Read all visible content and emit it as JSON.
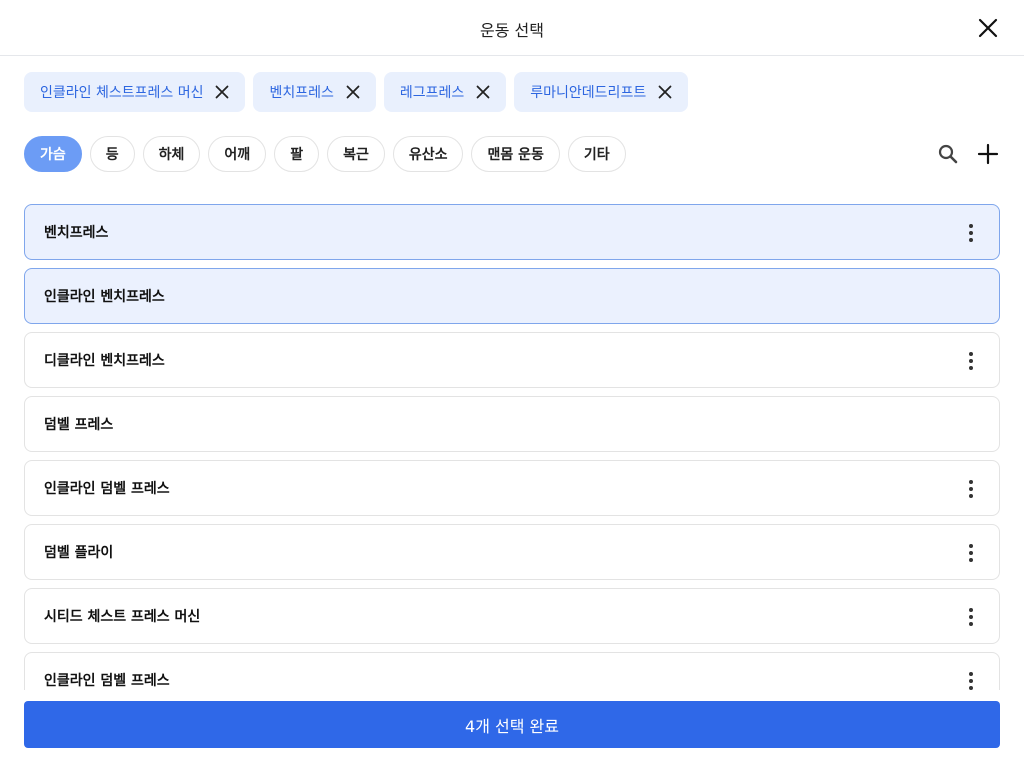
{
  "header": {
    "title": "운동 선택",
    "close_icon": "close-icon"
  },
  "selected_chips": [
    {
      "label": "인클라인 체스트프레스 머신"
    },
    {
      "label": "벤치프레스"
    },
    {
      "label": "레그프레스"
    },
    {
      "label": "루마니안데드리프트"
    }
  ],
  "category_tabs": [
    {
      "label": "가슴",
      "active": true
    },
    {
      "label": "등"
    },
    {
      "label": "하체"
    },
    {
      "label": "어깨"
    },
    {
      "label": "팔"
    },
    {
      "label": "복근"
    },
    {
      "label": "유산소"
    },
    {
      "label": "맨몸 운동"
    },
    {
      "label": "기타"
    }
  ],
  "toolbar": {
    "search_icon": "search-icon",
    "add_icon": "plus-icon"
  },
  "exercises": [
    {
      "name": "벤치프레스",
      "selected": true,
      "menu": true
    },
    {
      "name": "인클라인 벤치프레스",
      "selected": true,
      "menu": false
    },
    {
      "name": "디클라인 벤치프레스",
      "selected": false,
      "menu": true
    },
    {
      "name": "덤벨 프레스",
      "selected": false,
      "menu": false
    },
    {
      "name": "인클라인 덤벨 프레스",
      "selected": false,
      "menu": true
    },
    {
      "name": "덤벨 플라이",
      "selected": false,
      "menu": true
    },
    {
      "name": "시티드 체스트 프레스 머신",
      "selected": false,
      "menu": true
    },
    {
      "name": "인클라인 덤벨 프레스",
      "selected": false,
      "menu": true
    }
  ],
  "footer": {
    "confirm_label": "4개 선택 완료"
  },
  "colors": {
    "accent": "#2f68e8",
    "chip_bg": "#e9f0fd",
    "chip_text": "#2d66e0",
    "tab_active": "#6c9cf5",
    "row_selected_bg": "#ebf1fe",
    "row_selected_border": "#7fa6ec"
  }
}
